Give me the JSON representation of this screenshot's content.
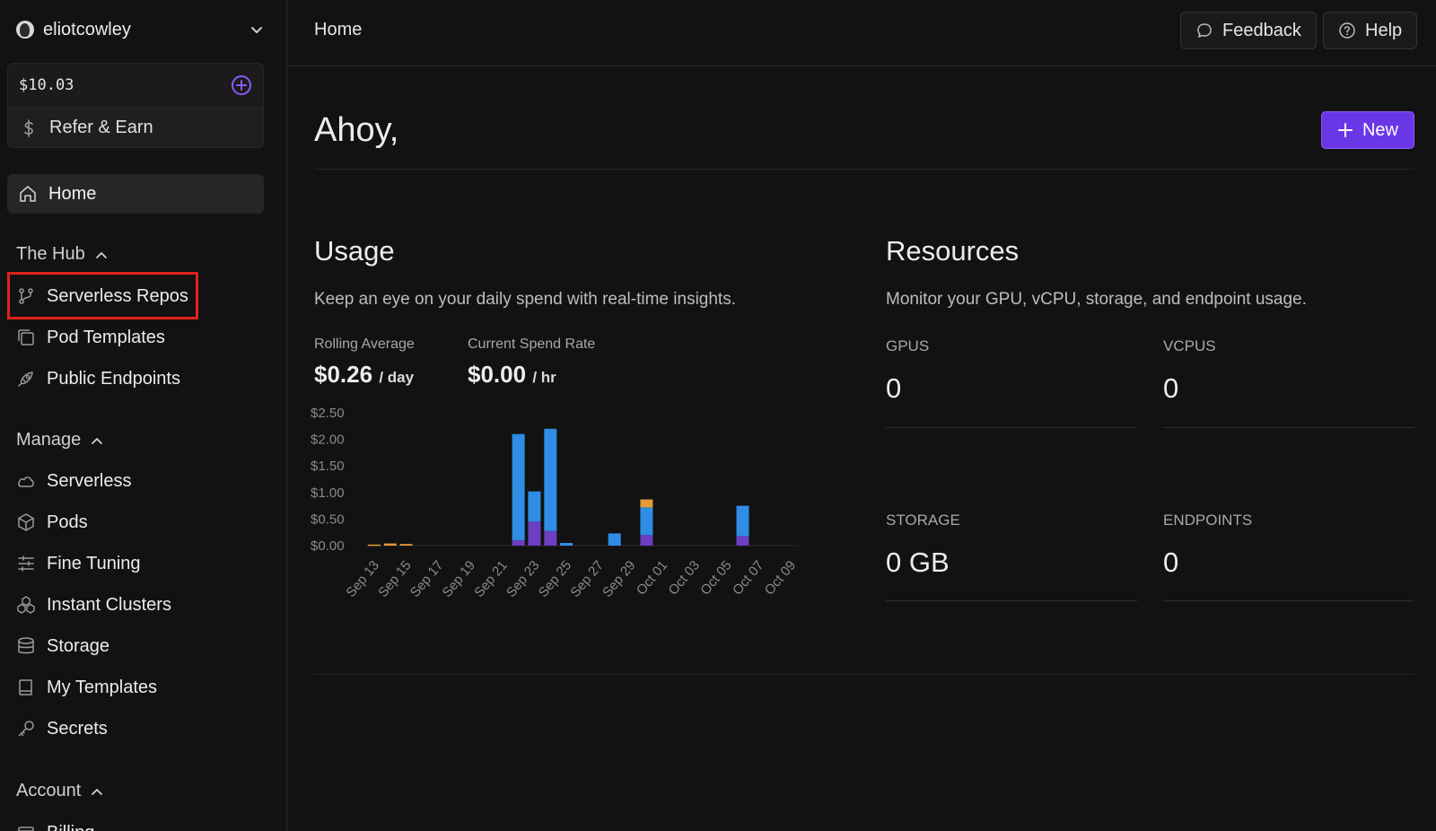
{
  "sidebar": {
    "account": {
      "username": "eliotcowley"
    },
    "balance": "$10.03",
    "refer": "Refer & Earn",
    "home": "Home",
    "hub": {
      "title": "The Hub",
      "items": [
        "Serverless Repos",
        "Pod Templates",
        "Public Endpoints"
      ]
    },
    "manage": {
      "title": "Manage",
      "items": [
        "Serverless",
        "Pods",
        "Fine Tuning",
        "Instant Clusters",
        "Storage",
        "My Templates",
        "Secrets"
      ]
    },
    "account_section": {
      "title": "Account",
      "items": [
        "Billing"
      ]
    }
  },
  "header": {
    "breadcrumb": "Home",
    "feedback": "Feedback",
    "help": "Help"
  },
  "main": {
    "greeting": "Ahoy,",
    "new_button": "New",
    "usage": {
      "title": "Usage",
      "subtitle": "Keep an eye on your daily spend with real-time insights.",
      "rolling_label": "Rolling Average",
      "rolling_value": "$0.26",
      "rolling_unit": "/ day",
      "rate_label": "Current Spend Rate",
      "rate_value": "$0.00",
      "rate_unit": "/ hr"
    },
    "resources": {
      "title": "Resources",
      "subtitle": "Monitor your GPU, vCPU, storage, and endpoint usage.",
      "gpus_label": "GPUS",
      "gpus_value": "0",
      "vcpus_label": "VCPUS",
      "vcpus_value": "0",
      "storage_label": "STORAGE",
      "storage_value": "0 GB",
      "endpoints_label": "ENDPOINTS",
      "endpoints_value": "0"
    }
  },
  "colors": {
    "accent": "#6a37e6",
    "highlight": "#e0221c",
    "series_blue": "#2f8de4",
    "series_purple": "#6b3fbf",
    "series_orange": "#e69a3a"
  },
  "chart_data": {
    "type": "bar",
    "stacked": true,
    "ylim": [
      0,
      2.5
    ],
    "yticks": [
      "$2.50",
      "$2.00",
      "$1.50",
      "$1.00",
      "$0.50",
      "$0.00"
    ],
    "tick_labels": [
      "Sep 13",
      "Sep 15",
      "Sep 17",
      "Sep 19",
      "Sep 21",
      "Sep 23",
      "Sep 25",
      "Sep 27",
      "Sep 29",
      "Oct 01",
      "Oct 03",
      "Oct 05",
      "Oct 07",
      "Oct 09"
    ],
    "categories": [
      "Sep 13",
      "Sep 14",
      "Sep 15",
      "Sep 16",
      "Sep 17",
      "Sep 18",
      "Sep 19",
      "Sep 20",
      "Sep 21",
      "Sep 22",
      "Sep 23",
      "Sep 24",
      "Sep 25",
      "Sep 26",
      "Sep 27",
      "Sep 28",
      "Sep 29",
      "Sep 30",
      "Oct 01",
      "Oct 02",
      "Oct 03",
      "Oct 04",
      "Oct 05",
      "Oct 06",
      "Oct 07",
      "Oct 08",
      "Oct 09"
    ],
    "series": [
      {
        "color": "#6b3fbf",
        "values": [
          0,
          0,
          0,
          0,
          0,
          0,
          0,
          0,
          0,
          0.1,
          0.45,
          0.28,
          0,
          0,
          0,
          0,
          0,
          0.2,
          0,
          0,
          0,
          0,
          0,
          0.18,
          0,
          0,
          0
        ]
      },
      {
        "color": "#2f8de4",
        "values": [
          0,
          0,
          0,
          0,
          0,
          0,
          0,
          0,
          0,
          2.0,
          0.57,
          1.92,
          0.05,
          0,
          0,
          0.23,
          0,
          0.52,
          0,
          0,
          0,
          0,
          0,
          0.57,
          0,
          0,
          0
        ]
      },
      {
        "color": "#e69a3a",
        "values": [
          0.02,
          0.04,
          0.03,
          0,
          0,
          0,
          0,
          0,
          0,
          0,
          0,
          0,
          0,
          0,
          0,
          0,
          0,
          0.15,
          0,
          0,
          0,
          0,
          0,
          0,
          0,
          0,
          0
        ]
      }
    ]
  }
}
